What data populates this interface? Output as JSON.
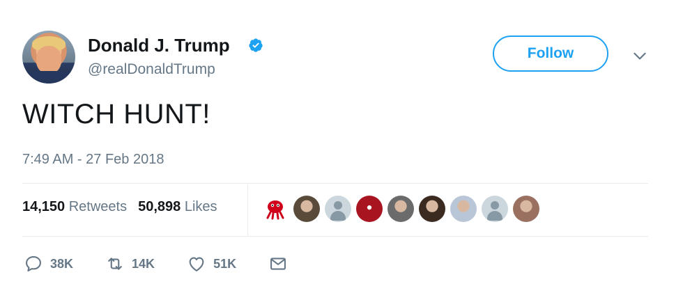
{
  "user": {
    "name": "Donald J. Trump",
    "handle": "@realDonaldTrump",
    "verified_icon": "verified-badge-icon",
    "avatar_icon": "user-avatar"
  },
  "header": {
    "follow_label": "Follow",
    "menu_icon": "chevron-down-icon"
  },
  "tweet": {
    "text": "WITCH HUNT!",
    "timestamp": "7:49 AM - 27 Feb 2018"
  },
  "stats": {
    "retweets_count": "14,150",
    "retweets_label": "Retweets",
    "likes_count": "50,898",
    "likes_label": "Likes"
  },
  "likers": [
    {
      "kind": "red-mascot",
      "color": "#d0021b"
    },
    {
      "kind": "photo",
      "color": "#5a4a3a"
    },
    {
      "kind": "default",
      "color": "#ccd6dd"
    },
    {
      "kind": "photo-red",
      "color": "#a81420"
    },
    {
      "kind": "photo",
      "color": "#6b6b6b"
    },
    {
      "kind": "photo",
      "color": "#3a2a20"
    },
    {
      "kind": "photo",
      "color": "#b8c6d8"
    },
    {
      "kind": "default",
      "color": "#ccd6dd"
    },
    {
      "kind": "photo",
      "color": "#9a7060"
    }
  ],
  "actions": {
    "reply_count": "38K",
    "retweet_count": "14K",
    "like_count": "51K",
    "reply_icon": "reply-icon",
    "retweet_icon": "retweet-icon",
    "like_icon": "heart-icon",
    "dm_icon": "envelope-icon"
  },
  "colors": {
    "accent": "#1da1f2",
    "secondary_text": "#657786",
    "primary_text": "#14171a",
    "divider": "#e6ecf0"
  }
}
